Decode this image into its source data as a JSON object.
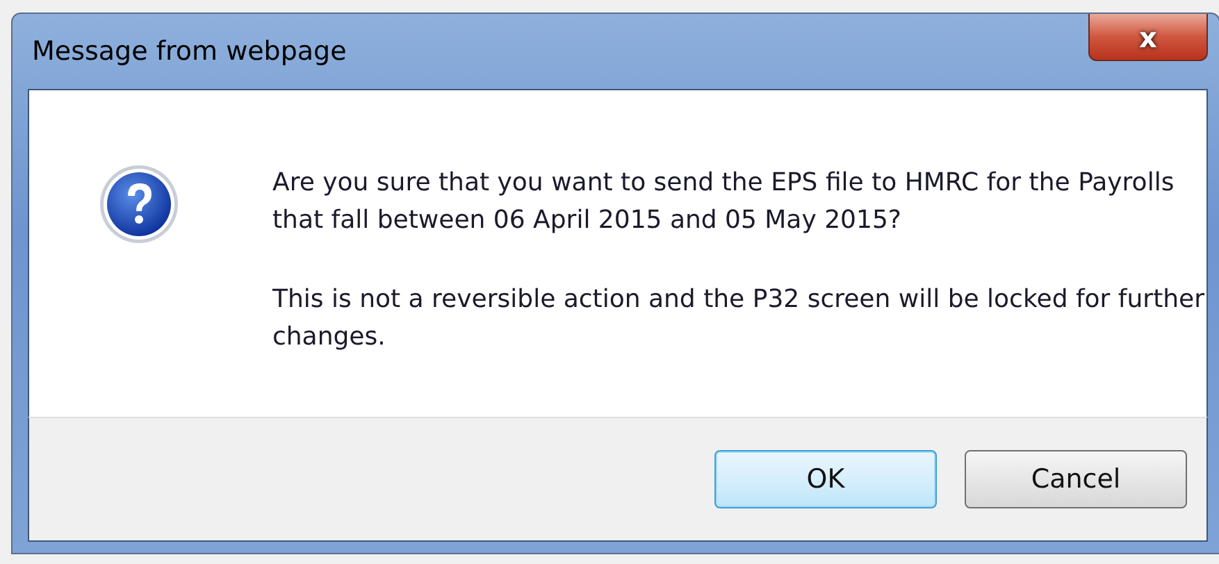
{
  "window": {
    "title": "Message from webpage",
    "close_label": "x"
  },
  "message": {
    "paragraphs": [
      "Are you sure that you want to send the EPS file to HMRC for the Payrolls that fall between 06 April 2015 and 05 May 2015?",
      "This is not a reversible action and the P32 screen will be locked for further changes."
    ]
  },
  "buttons": [
    {
      "label": "OK",
      "default": true
    },
    {
      "label": "Cancel",
      "default": false
    }
  ]
}
